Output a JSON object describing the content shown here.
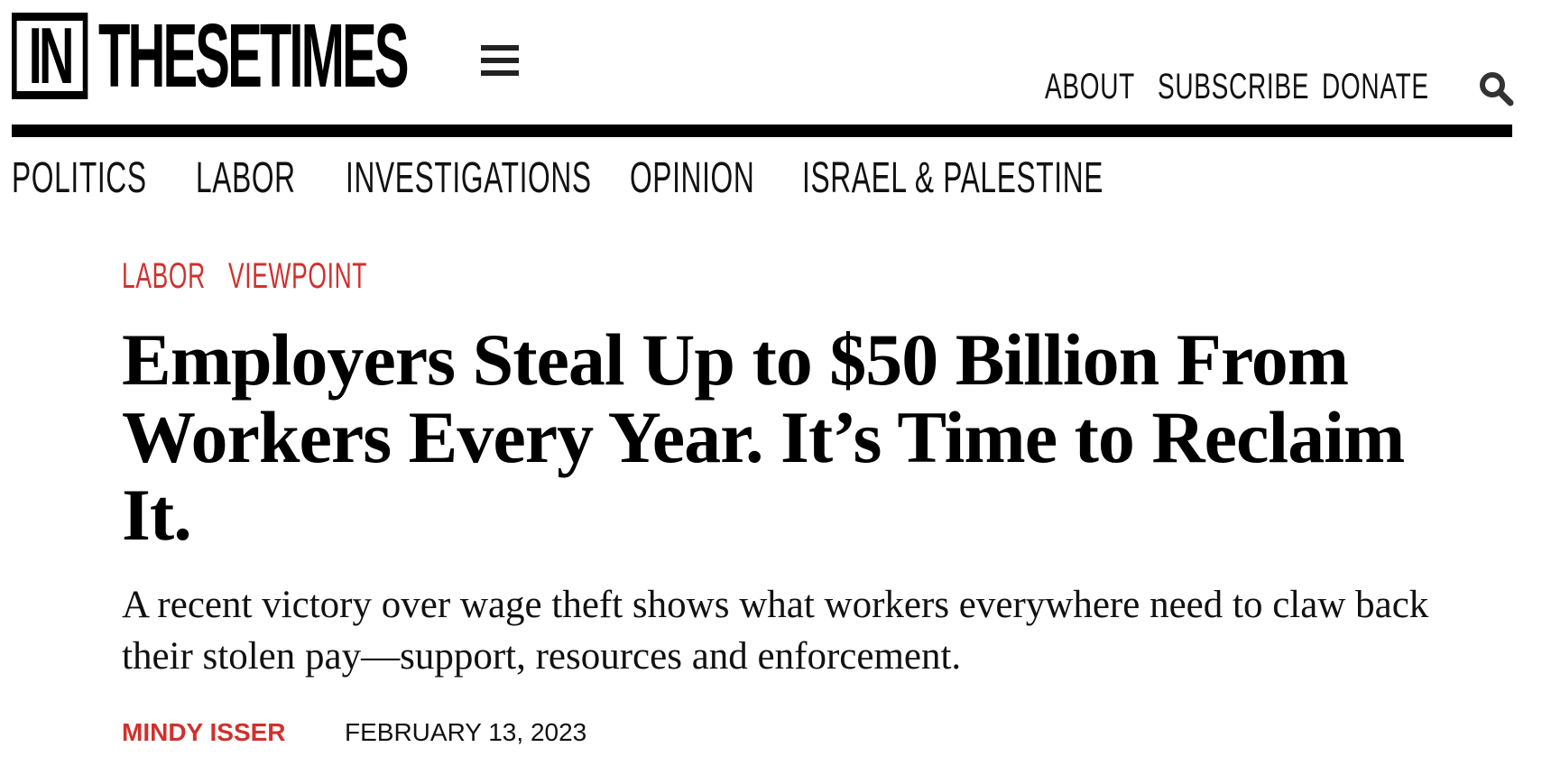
{
  "brand": {
    "logo_box_text": "IN",
    "logo_word_text": "THESETIMES"
  },
  "header": {
    "menu_icon": "hamburger-menu-icon",
    "links": {
      "about": "ABOUT",
      "subscribe": "SUBSCRIBE",
      "donate": "DONATE"
    },
    "search_icon": "search-icon"
  },
  "section_nav": {
    "items": [
      "POLITICS",
      "LABOR",
      "INVESTIGATIONS",
      "OPINION",
      "ISRAEL & PALESTINE"
    ]
  },
  "article": {
    "tags": [
      "LABOR",
      "VIEWPOINT"
    ],
    "headline": "Employers Steal Up to $50 Billion From Workers Every Year. It’s Time to Reclaim It.",
    "dek": "A recent victory over wage theft shows what workers everywhere need to claw back their stolen pay—support, resources and enforcement.",
    "author": "MINDY ISSER",
    "date": "FEBRUARY 13, 2023"
  },
  "colors": {
    "accent": "#d0312d",
    "text": "#111111",
    "background": "#ffffff"
  }
}
